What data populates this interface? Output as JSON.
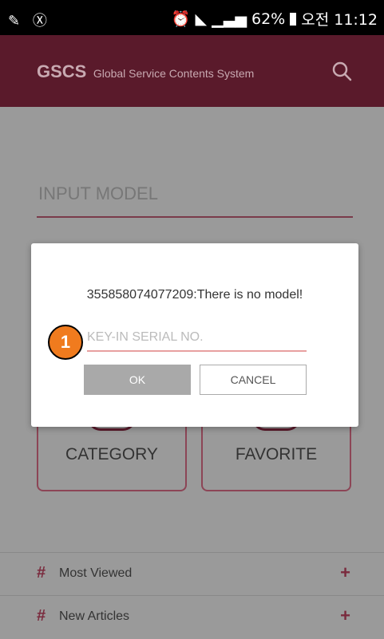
{
  "status_bar": {
    "left_icons": [
      "edit-icon",
      "accessibility-icon"
    ],
    "battery": "62%",
    "time": "오전 11:12"
  },
  "header": {
    "logo": "GSCS",
    "subtitle": "Global Service Contents System",
    "background_color": "#5a1a2b"
  },
  "main": {
    "input_model_label": "INPUT MODEL",
    "cards": [
      {
        "label": "CATEGORY"
      },
      {
        "label": "FAVORITE"
      }
    ],
    "bottom_list": [
      {
        "label": "Most Viewed"
      },
      {
        "label": "New Articles"
      }
    ]
  },
  "dialog": {
    "message": "355858074077209:There is no model!",
    "serial_placeholder": "KEY-IN SERIAL NO.",
    "ok_label": "OK",
    "cancel_label": "CANCEL"
  },
  "annotation": {
    "step_number": "1",
    "color": "#f07b1e"
  }
}
